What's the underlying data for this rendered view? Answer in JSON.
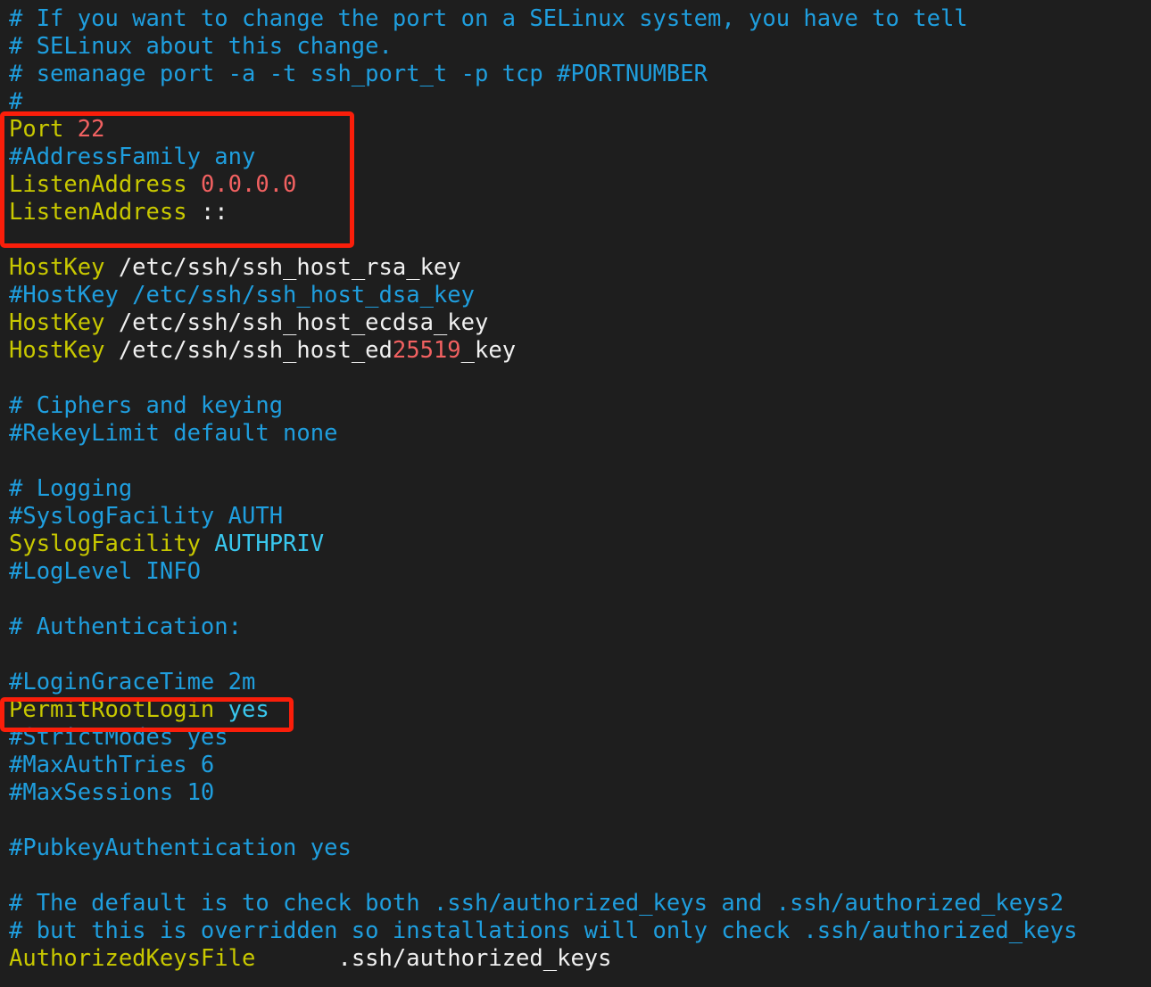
{
  "window": {
    "title": "sshd_config",
    "background_color": "#1e1e1e"
  },
  "theme": {
    "comment_color": "#1f9ede",
    "keyword_color": "#c8c800",
    "string_color": "#f0f0f0",
    "number_color": "#f26161",
    "value_color": "#39c7ee",
    "highlight_box_color": "#fa1e0a"
  },
  "file": {
    "lines": [
      {
        "n": 1,
        "segments": [
          {
            "t": "# If you want to change the port on a SELinux system, you have to tell",
            "c": "comment"
          }
        ]
      },
      {
        "n": 2,
        "segments": [
          {
            "t": "# SELinux about this change.",
            "c": "comment"
          }
        ]
      },
      {
        "n": 3,
        "segments": [
          {
            "t": "# semanage port -a -t ssh_port_t -p tcp #PORTNUMBER",
            "c": "comment"
          }
        ]
      },
      {
        "n": 4,
        "segments": [
          {
            "t": "#",
            "c": "comment"
          }
        ]
      },
      {
        "n": 5,
        "segments": [
          {
            "t": "Port ",
            "c": "key"
          },
          {
            "t": "22",
            "c": "number"
          }
        ]
      },
      {
        "n": 6,
        "segments": [
          {
            "t": "#AddressFamily any",
            "c": "comment"
          }
        ]
      },
      {
        "n": 7,
        "segments": [
          {
            "t": "ListenAddress ",
            "c": "key"
          },
          {
            "t": "0.0.0.0",
            "c": "number"
          }
        ]
      },
      {
        "n": 8,
        "segments": [
          {
            "t": "ListenAddress ",
            "c": "key"
          },
          {
            "t": "::",
            "c": "white"
          }
        ]
      },
      {
        "n": 9,
        "segments": [
          {
            "t": "",
            "c": "comment"
          }
        ]
      },
      {
        "n": 10,
        "segments": [
          {
            "t": "HostKey ",
            "c": "key"
          },
          {
            "t": "/etc/ssh/ssh_host_rsa_key",
            "c": "white"
          }
        ]
      },
      {
        "n": 11,
        "segments": [
          {
            "t": "#HostKey /etc/ssh/ssh_host_dsa_key",
            "c": "comment"
          }
        ]
      },
      {
        "n": 12,
        "segments": [
          {
            "t": "HostKey ",
            "c": "key"
          },
          {
            "t": "/etc/ssh/ssh_host_ecdsa_key",
            "c": "white"
          }
        ]
      },
      {
        "n": 13,
        "segments": [
          {
            "t": "HostKey ",
            "c": "key"
          },
          {
            "t": "/etc/ssh/ssh_host_ed",
            "c": "white"
          },
          {
            "t": "25519",
            "c": "number"
          },
          {
            "t": "_key",
            "c": "white"
          }
        ]
      },
      {
        "n": 14,
        "segments": [
          {
            "t": "",
            "c": "comment"
          }
        ]
      },
      {
        "n": 15,
        "segments": [
          {
            "t": "# Ciphers and keying",
            "c": "comment"
          }
        ]
      },
      {
        "n": 16,
        "segments": [
          {
            "t": "#RekeyLimit default none",
            "c": "comment"
          }
        ]
      },
      {
        "n": 17,
        "segments": [
          {
            "t": "",
            "c": "comment"
          }
        ]
      },
      {
        "n": 18,
        "segments": [
          {
            "t": "# Logging",
            "c": "comment"
          }
        ]
      },
      {
        "n": 19,
        "segments": [
          {
            "t": "#SyslogFacility AUTH",
            "c": "comment"
          }
        ]
      },
      {
        "n": 20,
        "segments": [
          {
            "t": "SyslogFacility ",
            "c": "key"
          },
          {
            "t": "AUTHPRIV",
            "c": "value"
          }
        ]
      },
      {
        "n": 21,
        "segments": [
          {
            "t": "#LogLevel INFO",
            "c": "comment"
          }
        ]
      },
      {
        "n": 22,
        "segments": [
          {
            "t": "",
            "c": "comment"
          }
        ]
      },
      {
        "n": 23,
        "segments": [
          {
            "t": "# Authentication:",
            "c": "comment"
          }
        ]
      },
      {
        "n": 24,
        "segments": [
          {
            "t": "",
            "c": "comment"
          }
        ]
      },
      {
        "n": 25,
        "segments": [
          {
            "t": "#LoginGraceTime 2m",
            "c": "comment"
          }
        ]
      },
      {
        "n": 26,
        "segments": [
          {
            "t": "PermitRootLogin ",
            "c": "key"
          },
          {
            "t": "yes",
            "c": "value"
          }
        ]
      },
      {
        "n": 27,
        "segments": [
          {
            "t": "#StrictModes yes",
            "c": "comment"
          }
        ]
      },
      {
        "n": 28,
        "segments": [
          {
            "t": "#MaxAuthTries 6",
            "c": "comment"
          }
        ]
      },
      {
        "n": 29,
        "segments": [
          {
            "t": "#MaxSessions 10",
            "c": "comment"
          }
        ]
      },
      {
        "n": 30,
        "segments": [
          {
            "t": "",
            "c": "comment"
          }
        ]
      },
      {
        "n": 31,
        "segments": [
          {
            "t": "#PubkeyAuthentication yes",
            "c": "comment"
          }
        ]
      },
      {
        "n": 32,
        "segments": [
          {
            "t": "",
            "c": "comment"
          }
        ]
      },
      {
        "n": 33,
        "segments": [
          {
            "t": "# The default is to check both .ssh/authorized_keys and .ssh/authorized_keys2",
            "c": "comment"
          }
        ]
      },
      {
        "n": 34,
        "segments": [
          {
            "t": "# but this is overridden so installations will only check .ssh/authorized_keys",
            "c": "comment"
          }
        ]
      },
      {
        "n": 35,
        "segments": [
          {
            "t": "AuthorizedKeysFile",
            "c": "key"
          },
          {
            "t": "      ",
            "c": "white"
          },
          {
            "t": ".ssh/authorized_keys",
            "c": "white"
          }
        ]
      }
    ]
  },
  "annotations": [
    {
      "id": "listen-settings-highlight",
      "label": "Port / ListenAddress block highlight",
      "covers": [
        "Port 22",
        "#AddressFamily any",
        "ListenAddress 0.0.0.0",
        "ListenAddress ::"
      ]
    },
    {
      "id": "permitrootlogin-highlight",
      "label": "PermitRootLogin line highlight",
      "covers": [
        "PermitRootLogin yes"
      ]
    }
  ]
}
